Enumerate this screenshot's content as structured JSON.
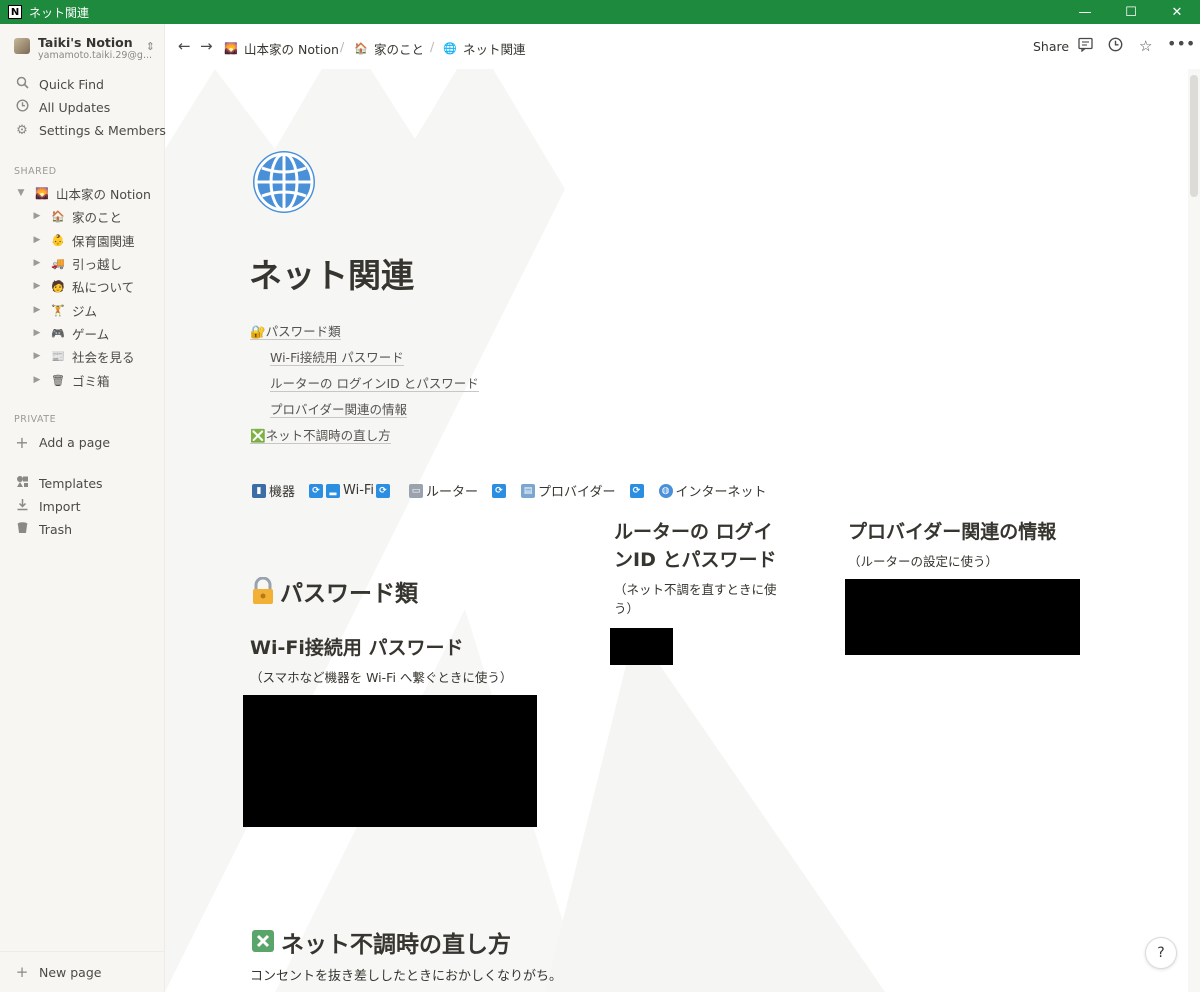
{
  "window": {
    "title": "ネット関連",
    "app_glyph": "N",
    "minimize": "—",
    "maximize": "☐",
    "close": "✕"
  },
  "sidebar": {
    "workspace_name": "Taiki's Notion",
    "workspace_email": "yamamoto.taiki.29@g...",
    "items": [
      {
        "label": "Quick Find",
        "icon": "search-icon"
      },
      {
        "label": "All Updates",
        "icon": "clock-icon"
      },
      {
        "label": "Settings & Members",
        "icon": "gear-icon"
      }
    ],
    "shared_label": "SHARED",
    "root_page": {
      "label": "山本家の Notion",
      "icon": "🌄"
    },
    "children": [
      {
        "label": "家のこと",
        "icon": "🏠"
      },
      {
        "label": "保育園関連",
        "icon": "👶"
      },
      {
        "label": "引っ越し",
        "icon": "🚚"
      },
      {
        "label": "私について",
        "icon": "🧑"
      },
      {
        "label": "ジム",
        "icon": "🏋"
      },
      {
        "label": "ゲーム",
        "icon": "🎮"
      },
      {
        "label": "社会を見る",
        "icon": "📰"
      },
      {
        "label": "ゴミ箱",
        "icon": "🗑"
      }
    ],
    "private_label": "PRIVATE",
    "add_page": "Add a page",
    "tools": [
      {
        "label": "Templates",
        "icon": "templates-icon"
      },
      {
        "label": "Import",
        "icon": "import-icon"
      },
      {
        "label": "Trash",
        "icon": "trash-icon"
      }
    ],
    "new_page": "New page"
  },
  "topbar": {
    "breadcrumbs": [
      {
        "label": "山本家の Notion",
        "icon": "🌄"
      },
      {
        "label": "家のこと",
        "icon": "🏠"
      },
      {
        "label": "ネット関連",
        "icon": "🌐"
      }
    ],
    "separator": "/",
    "share": "Share"
  },
  "page": {
    "title": "ネット関連",
    "toc": [
      {
        "label": "🔐パスワード類",
        "level": 0
      },
      {
        "label": "Wi-Fi接続用 パスワード",
        "level": 1
      },
      {
        "label": "ルーターの ログインID とパスワード",
        "level": 1
      },
      {
        "label": "プロバイダー関連の情報",
        "level": 1
      },
      {
        "label": "❎ネット不調時の直し方",
        "level": 0
      }
    ],
    "flow": {
      "device": "機器",
      "wifi": "Wi-Fi",
      "router": "ルーター",
      "provider": "プロバイダー",
      "internet": "インターネット"
    },
    "password_heading": "パスワード類",
    "wifi_heading": "Wi-Fi接続用 パスワード",
    "wifi_note": "（スマホなど機器を Wi-Fi へ繋ぐときに使う）",
    "router_heading_1": "ルーターの ログイ",
    "router_heading_2": "ンID とパスワード",
    "router_note_1": "（ネット不調を直すときに使",
    "router_note_2": "う）",
    "provider_heading": "プロバイダー関連の情報",
    "provider_note": "（ルーターの設定に使う）",
    "fix_heading": "ネット不調時の直し方",
    "fix_text": "コンセントを抜き差ししたときにおかしくなりがち。"
  },
  "help": "?",
  "colors": {
    "titlebar": "#1e8a3e",
    "sidebar_bg": "#f7f6f3",
    "text": "#37352f",
    "redaction": "#000000"
  }
}
